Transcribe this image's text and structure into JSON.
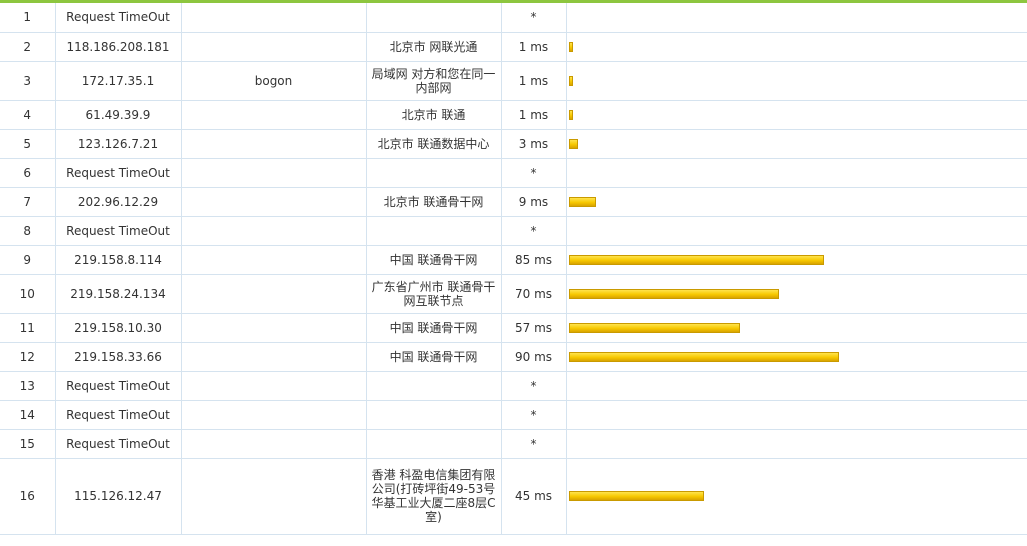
{
  "colors": {
    "accent_line": "#8dc63f",
    "bar": "#f7c800",
    "grid": "#d5e3ef"
  },
  "bar_scale_max_ms": 100,
  "hops": [
    {
      "hop": "1",
      "ip": "Request TimeOut",
      "host": "",
      "location": "",
      "time": "*",
      "ms": 0
    },
    {
      "hop": "2",
      "ip": "118.186.208.181",
      "host": "",
      "location": "北京市 网联光通",
      "time": "1 ms",
      "ms": 1
    },
    {
      "hop": "3",
      "ip": "172.17.35.1",
      "host": "bogon",
      "location": "局域网 对方和您在同一内部网",
      "time": "1 ms",
      "ms": 1
    },
    {
      "hop": "4",
      "ip": "61.49.39.9",
      "host": "",
      "location": "北京市 联通",
      "time": "1 ms",
      "ms": 1
    },
    {
      "hop": "5",
      "ip": "123.126.7.21",
      "host": "",
      "location": "北京市 联通数据中心",
      "time": "3 ms",
      "ms": 3
    },
    {
      "hop": "6",
      "ip": "Request TimeOut",
      "host": "",
      "location": "",
      "time": "*",
      "ms": 0
    },
    {
      "hop": "7",
      "ip": "202.96.12.29",
      "host": "",
      "location": "北京市 联通骨干网",
      "time": "9 ms",
      "ms": 9
    },
    {
      "hop": "8",
      "ip": "Request TimeOut",
      "host": "",
      "location": "",
      "time": "*",
      "ms": 0
    },
    {
      "hop": "9",
      "ip": "219.158.8.114",
      "host": "",
      "location": "中国 联通骨干网",
      "time": "85 ms",
      "ms": 85
    },
    {
      "hop": "10",
      "ip": "219.158.24.134",
      "host": "",
      "location": "广东省广州市 联通骨干网互联节点",
      "time": "70 ms",
      "ms": 70
    },
    {
      "hop": "11",
      "ip": "219.158.10.30",
      "host": "",
      "location": "中国 联通骨干网",
      "time": "57 ms",
      "ms": 57
    },
    {
      "hop": "12",
      "ip": "219.158.33.66",
      "host": "",
      "location": "中国 联通骨干网",
      "time": "90 ms",
      "ms": 90
    },
    {
      "hop": "13",
      "ip": "Request TimeOut",
      "host": "",
      "location": "",
      "time": "*",
      "ms": 0
    },
    {
      "hop": "14",
      "ip": "Request TimeOut",
      "host": "",
      "location": "",
      "time": "*",
      "ms": 0
    },
    {
      "hop": "15",
      "ip": "Request TimeOut",
      "host": "",
      "location": "",
      "time": "*",
      "ms": 0
    },
    {
      "hop": "16",
      "ip": "115.126.12.47",
      "host": "",
      "location": "香港 科盈电信集团有限公司(打砖坪街49-53号华基工业大厦二座8层C室)",
      "time": "45 ms",
      "ms": 45
    }
  ]
}
